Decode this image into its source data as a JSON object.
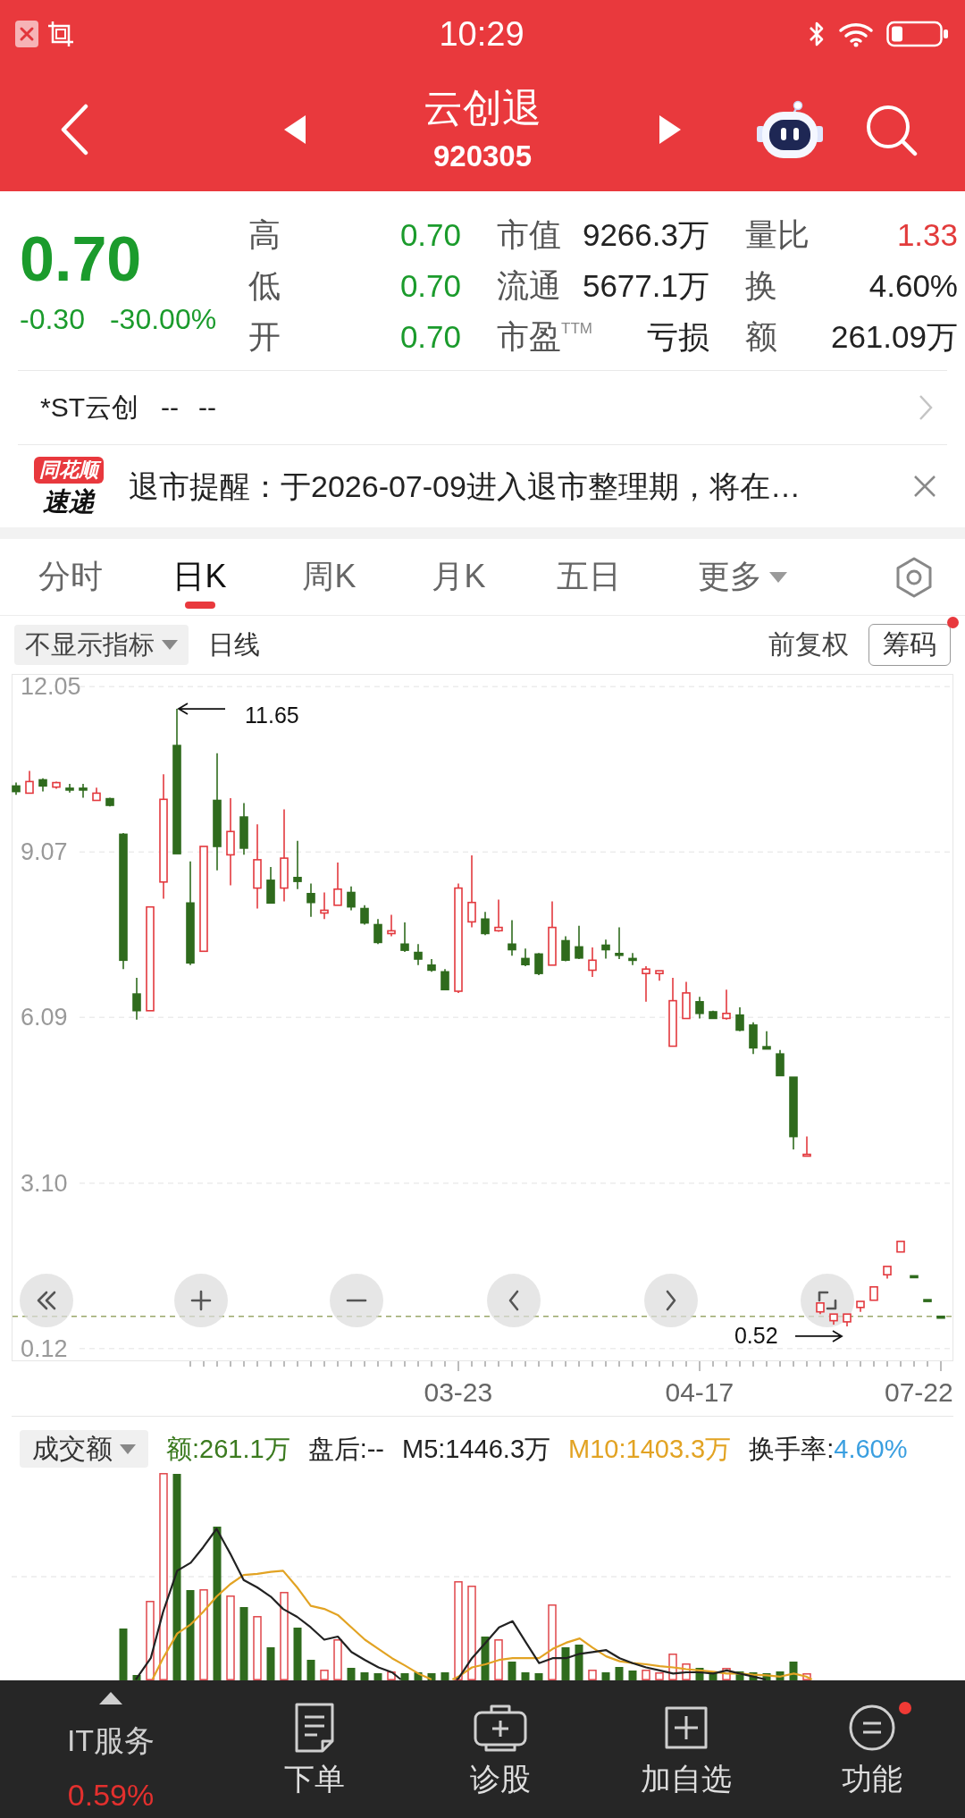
{
  "status_bar": {
    "time": "10:29"
  },
  "header": {
    "title": "云创退",
    "code": "920305"
  },
  "quote": {
    "price": "0.70",
    "change": "-0.30",
    "change_percent": "-30.00%",
    "falling": true,
    "stats": [
      {
        "label": "高",
        "value": "0.70",
        "color": "#1b9b2c"
      },
      {
        "label": "市值",
        "value": "9266.3万",
        "color": "#222222"
      },
      {
        "label": "量比",
        "value": "1.33",
        "color": "#e23b3b"
      },
      {
        "label": "低",
        "value": "0.70",
        "color": "#1b9b2c"
      },
      {
        "label": "流通",
        "value": "5677.1万",
        "color": "#222222"
      },
      {
        "label": "换",
        "value": "4.60%",
        "color": "#222222"
      },
      {
        "label": "开",
        "value": "0.70",
        "color": "#1b9b2c"
      },
      {
        "label": "市盈$^{TTM}$",
        "value": "亏损",
        "color": "#222222"
      },
      {
        "label": "额",
        "value": "261.09万",
        "color": "#222222"
      }
    ]
  },
  "related": {
    "name": "*ST云创",
    "price": "--",
    "change": "--"
  },
  "notice": {
    "source": "同花顺",
    "source_tag": "速递",
    "text": "退市提醒：于2026-07-09进入退市整理期，将在…"
  },
  "tabs": [
    {
      "label": "分时",
      "kind": "tab",
      "selected": false
    },
    {
      "label": "日K",
      "kind": "tab",
      "selected": true
    },
    {
      "label": "周K",
      "kind": "tab",
      "selected": false
    },
    {
      "label": "月K",
      "kind": "tab",
      "selected": false
    },
    {
      "label": "五日",
      "kind": "tab",
      "selected": false
    },
    {
      "label": "更多",
      "kind": "menu",
      "selected": false
    }
  ],
  "chart_toolbar": {
    "indicator": "不显示指标",
    "period": "日线",
    "adjustment": "前复权",
    "chips": "筹码",
    "chips_dot": true
  },
  "kline": {
    "chart_data": {
      "type": "candlestick",
      "categories": [
        null,
        null,
        null,
        null,
        null,
        null,
        null,
        null,
        null,
        null,
        null,
        null,
        null,
        null,
        null,
        null,
        null,
        null,
        null,
        null,
        null,
        null,
        null,
        null,
        null,
        null,
        null,
        null,
        null,
        null,
        null,
        null,
        null,
        "03-23",
        null,
        null,
        null,
        null,
        null,
        null,
        null,
        null,
        null,
        null,
        null,
        null,
        null,
        null,
        null,
        null,
        null,
        "04-17",
        null,
        null,
        null,
        null,
        null,
        null,
        null,
        null,
        null,
        null,
        null,
        null,
        null,
        null,
        null,
        null,
        null,
        "07-22"
      ],
      "ohlc": [
        [
          10.26,
          10.32,
          10.1,
          10.16
        ],
        [
          10.13,
          10.53,
          10.13,
          10.34
        ],
        [
          10.37,
          10.4,
          10.16,
          10.26
        ],
        [
          10.24,
          10.34,
          10.21,
          10.32
        ],
        [
          10.22,
          10.3,
          10.14,
          10.2
        ],
        [
          10.22,
          10.3,
          10.05,
          10.2
        ],
        [
          10.0,
          10.23,
          10.0,
          10.13
        ],
        [
          10.03,
          10.05,
          9.89,
          9.91
        ],
        [
          9.39,
          9.41,
          6.96,
          7.12
        ],
        [
          6.51,
          6.8,
          6.05,
          6.21
        ],
        [
          6.21,
          8.08,
          6.21,
          8.08
        ],
        [
          8.53,
          10.47,
          8.23,
          10.02
        ],
        [
          10.99,
          11.65,
          9.04,
          9.04
        ],
        [
          8.15,
          8.9,
          7.03,
          7.07
        ],
        [
          7.28,
          9.17,
          7.28,
          9.17
        ],
        [
          10.0,
          10.85,
          8.74,
          9.17
        ],
        [
          9.02,
          10.04,
          8.47,
          9.44
        ],
        [
          9.7,
          9.95,
          9.02,
          9.14
        ],
        [
          8.42,
          9.57,
          8.05,
          8.93
        ],
        [
          8.56,
          8.8,
          8.15,
          8.15
        ],
        [
          8.42,
          9.84,
          8.18,
          8.96
        ],
        [
          8.61,
          9.27,
          8.4,
          8.54
        ],
        [
          8.32,
          8.5,
          7.9,
          8.16
        ],
        [
          7.97,
          8.34,
          7.86,
          8.02
        ],
        [
          8.11,
          8.88,
          8.11,
          8.4
        ],
        [
          8.34,
          8.45,
          8.02,
          8.08
        ],
        [
          8.05,
          8.11,
          7.76,
          7.79
        ],
        [
          7.76,
          7.86,
          7.41,
          7.44
        ],
        [
          7.6,
          7.94,
          7.55,
          7.65
        ],
        [
          7.41,
          7.8,
          7.27,
          7.3
        ],
        [
          7.26,
          7.41,
          7.03,
          7.14
        ],
        [
          7.03,
          7.14,
          6.91,
          6.94
        ],
        [
          6.91,
          6.96,
          6.59,
          6.59
        ],
        [
          6.56,
          8.5,
          6.53,
          8.42
        ],
        [
          7.81,
          9.01,
          7.71,
          8.16
        ],
        [
          7.86,
          7.99,
          7.57,
          7.6
        ],
        [
          7.65,
          8.21,
          7.63,
          7.71
        ],
        [
          7.41,
          7.84,
          7.2,
          7.31
        ],
        [
          7.15,
          7.33,
          7.01,
          7.04
        ],
        [
          7.23,
          7.25,
          6.85,
          6.88
        ],
        [
          7.03,
          8.18,
          7.03,
          7.71
        ],
        [
          7.47,
          7.55,
          7.1,
          7.12
        ],
        [
          7.36,
          7.74,
          7.14,
          7.16
        ],
        [
          6.94,
          7.35,
          6.82,
          7.12
        ],
        [
          7.39,
          7.49,
          7.15,
          7.31
        ],
        [
          7.24,
          7.71,
          7.14,
          7.21
        ],
        [
          7.15,
          7.25,
          7.03,
          7.13
        ],
        [
          6.88,
          7.01,
          6.37,
          6.96
        ],
        [
          6.88,
          6.93,
          6.75,
          6.93
        ],
        [
          5.57,
          6.8,
          5.57,
          6.39
        ],
        [
          6.07,
          6.73,
          6.07,
          6.53
        ],
        [
          6.37,
          6.46,
          6.07,
          6.16
        ],
        [
          6.19,
          6.21,
          6.07,
          6.07
        ],
        [
          6.07,
          6.59,
          6.05,
          6.16
        ],
        [
          6.13,
          6.27,
          5.84,
          5.86
        ],
        [
          5.95,
          6.0,
          5.43,
          5.54
        ],
        [
          5.56,
          5.84,
          5.52,
          5.52
        ],
        [
          5.43,
          5.5,
          5.03,
          5.04
        ],
        [
          5.01,
          5.01,
          3.71,
          3.94
        ],
        [
          3.59,
          3.94,
          3.59,
          3.62
        ],
        [
          0.78,
          0.94,
          0.74,
          0.94
        ],
        [
          0.62,
          0.74,
          0.55,
          0.74
        ],
        [
          0.6,
          0.74,
          0.52,
          0.74
        ],
        [
          0.86,
          0.97,
          0.78,
          0.97
        ],
        [
          0.99,
          1.23,
          0.99,
          1.23
        ],
        [
          1.45,
          1.6,
          1.38,
          1.6
        ],
        [
          1.86,
          2.05,
          1.86,
          2.05
        ],
        [
          1.43,
          1.43,
          1.43,
          1.43
        ],
        [
          1.0,
          1.0,
          1.0,
          1.0
        ],
        [
          0.7,
          0.7,
          0.7,
          0.7
        ]
      ],
      "ylim": [
        -0.11,
        12.28
      ],
      "yticks": [
        {
          "value": 12.05,
          "label": "12.05"
        },
        {
          "value": 9.07,
          "label": "9.07"
        },
        {
          "value": 6.09,
          "label": "6.09"
        },
        {
          "value": 3.1,
          "label": "3.10"
        },
        {
          "value": 0.12,
          "label": "0.12"
        }
      ],
      "grid": true,
      "ref_lines": [
        {
          "axis": "y",
          "value": 0.7
        }
      ],
      "annotations": [
        "11.65",
        "0.52"
      ]
    }
  },
  "volume": {
    "selector": "成交额",
    "legend": [
      {
        "text": "额:261.1万",
        "color": "#3b7a1f"
      },
      {
        "text": "盘后:--",
        "color": "#222222"
      },
      {
        "text": "M5:1446.3万",
        "color": "#222222"
      },
      {
        "text": "M10:1403.3万",
        "color": "#e2a323"
      }
    ],
    "turnover": {
      "label": "换手率:",
      "value": "4.60%"
    }
  },
  "bottom_bar": {
    "sector": {
      "name": "IT服务",
      "change": "0.59%",
      "rising": true
    },
    "items": [
      {
        "label": "下单",
        "kind": "order",
        "dot": false
      },
      {
        "label": "诊股",
        "kind": "diagnose",
        "dot": false
      },
      {
        "label": "加自选",
        "kind": "add",
        "dot": false
      },
      {
        "label": "功能",
        "kind": "menu",
        "dot": true
      }
    ]
  }
}
